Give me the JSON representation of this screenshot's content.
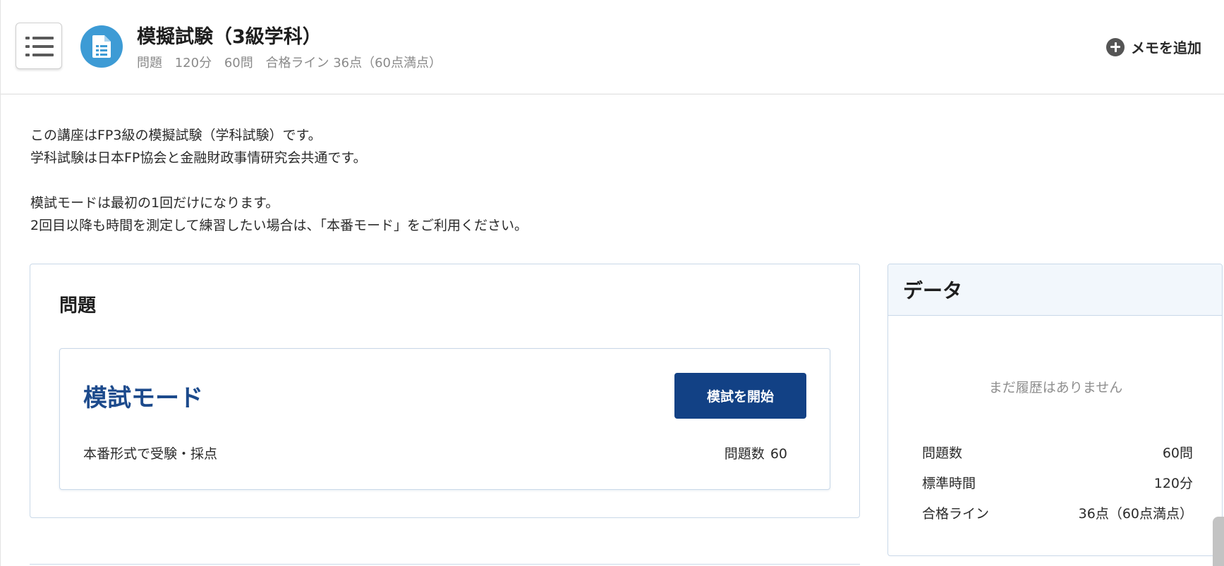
{
  "header": {
    "menu_icon": "list-menu-icon",
    "doc_icon": "document-icon",
    "title": "模擬試験（3級学科）",
    "meta": [
      "問題",
      "120分",
      "60問",
      "合格ライン 36点（60点満点）"
    ],
    "memo_icon": "plus-circle-icon",
    "memo_label": "メモを追加"
  },
  "description": {
    "lines_1": [
      "この講座はFP3級の模擬試験（学科試験）です。",
      "学科試験は日本FP協会と金融財政事情研究会共通です。"
    ],
    "lines_2": [
      "模試モードは最初の1回だけになります。",
      "2回目以降も時間を測定して練習したい場合は、「本番モード」をご利用ください。"
    ]
  },
  "problem_panel": {
    "heading": "問題",
    "mode": {
      "title": "模試モード",
      "start_label": "模試を開始",
      "description": "本番形式で受験・採点",
      "count_label": "問題数",
      "count_value": "60"
    }
  },
  "data_panel": {
    "heading": "データ",
    "empty_message": "まだ履歴はありません",
    "stats": [
      {
        "label": "問題数",
        "value": "60問"
      },
      {
        "label": "標準時間",
        "value": "120分"
      },
      {
        "label": "合格ライン",
        "value": "36点（60点満点）"
      }
    ]
  },
  "colors": {
    "accent": "#124185",
    "mode_title": "#1c4a8c",
    "doc_badge": "#3d9bd5",
    "panel_border": "#c9d8e8",
    "data_head_bg": "#f2f7fc"
  }
}
